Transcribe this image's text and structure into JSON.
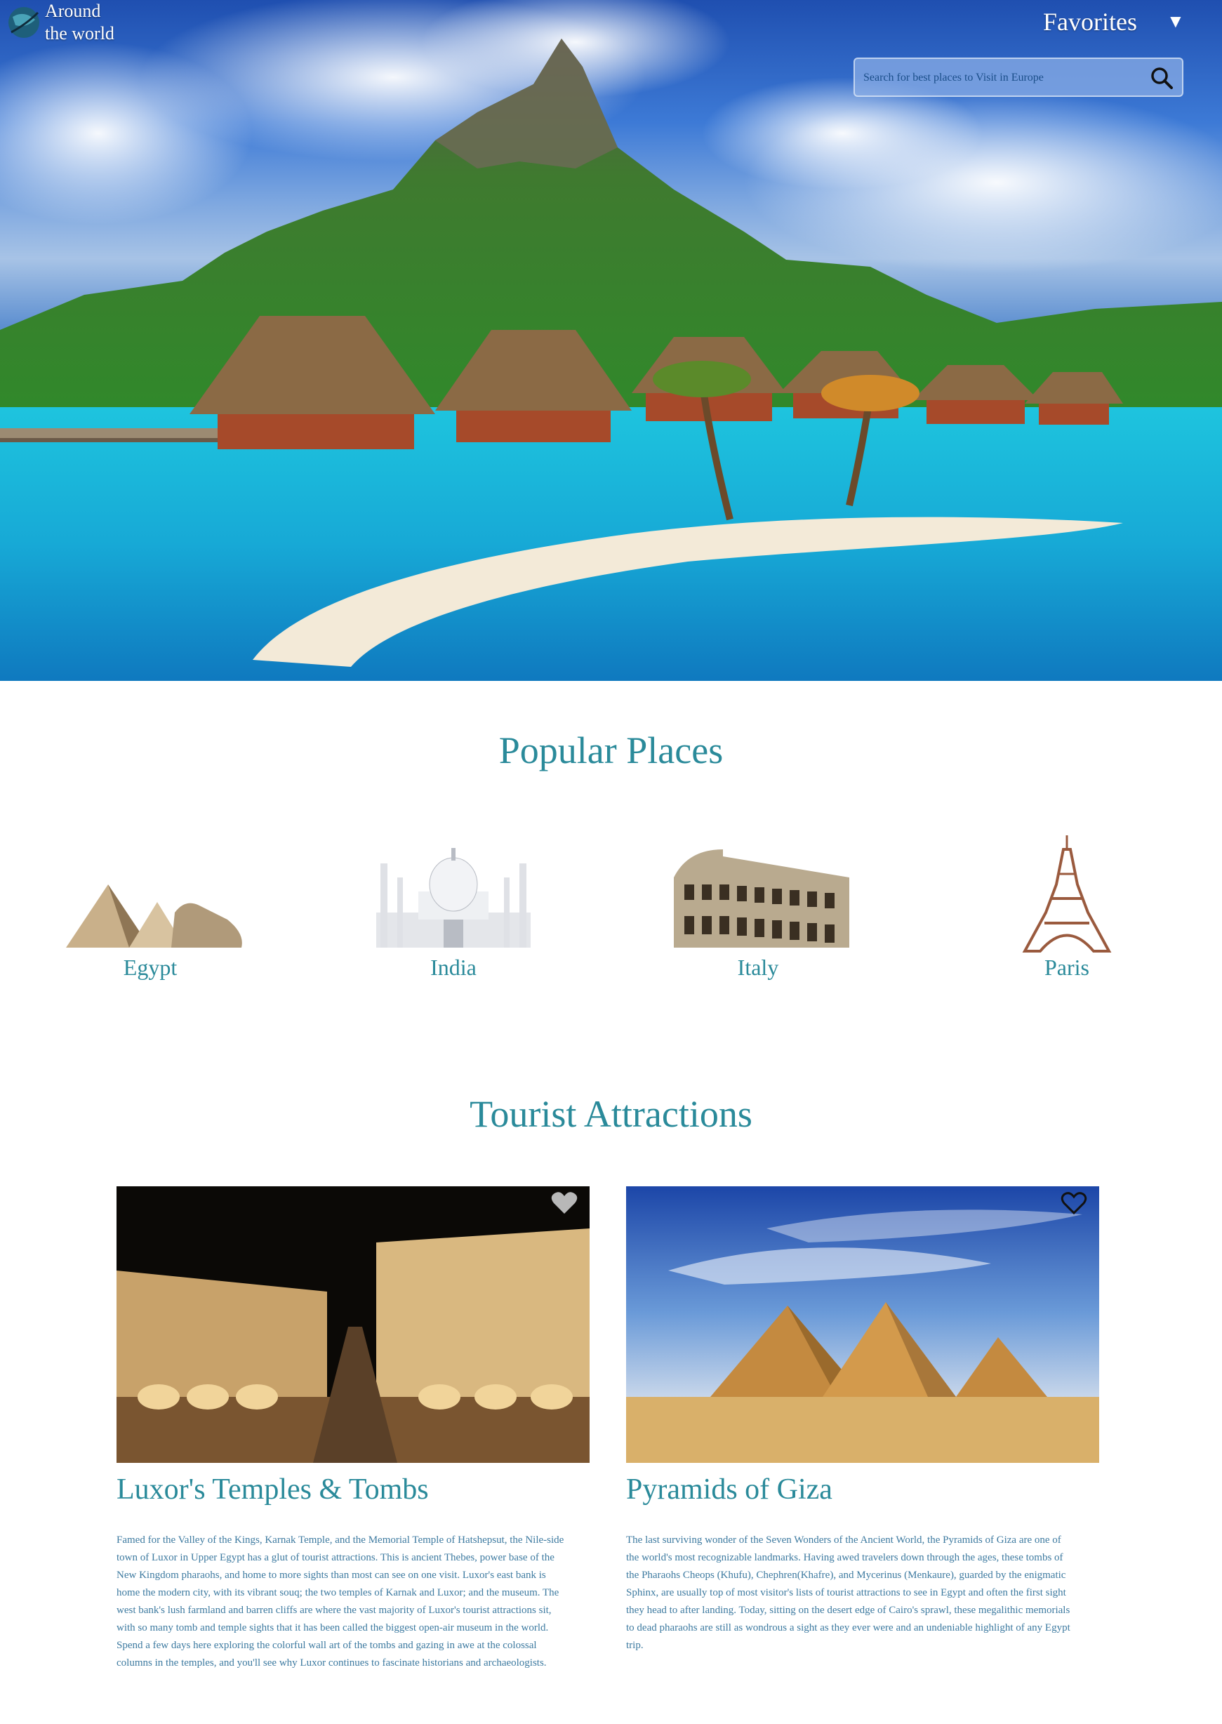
{
  "header": {
    "brand_line1": "Around",
    "brand_line2": "the world",
    "favorites_label": "Favorites",
    "favorites_caret": "▼",
    "search_placeholder": "Search for best places to Visit in Europe"
  },
  "popular": {
    "title": "Popular Places",
    "places": [
      {
        "label": "Egypt",
        "icon": "pyramids-sphinx"
      },
      {
        "label": "India",
        "icon": "taj-mahal"
      },
      {
        "label": "Italy",
        "icon": "colosseum"
      },
      {
        "label": "Paris",
        "icon": "eiffel-tower"
      }
    ]
  },
  "attractions": {
    "title": "Tourist Attractions",
    "cards": [
      {
        "title": "Luxor's Temples & Tombs",
        "favorited": true,
        "text": "Famed for the Valley of the Kings, Karnak Temple, and the Memorial Temple of Hatshepsut, the Nile-side town of Luxor in Upper Egypt has a glut of tourist attractions. This is ancient Thebes, power base of the New Kingdom pharaohs, and home to more sights than most can see on one visit. Luxor's east bank is home the modern city, with its vibrant souq; the two temples of Karnak and Luxor; and the museum. The west bank's lush farmland and barren cliffs are where the vast majority of Luxor's tourist attractions sit, with so many tomb and temple sights that it has been called the biggest open-air museum in the world. Spend a few days here exploring the colorful wall art of the tombs and gazing in awe at the colossal columns in the temples, and you'll see why Luxor continues to fascinate historians and archaeologists."
      },
      {
        "title": "Pyramids of Giza",
        "favorited": false,
        "text": "The last surviving wonder of the Seven Wonders of the Ancient World, the Pyramids of Giza are one of the world's most recognizable landmarks. Having awed travelers down through the ages, these tombs of the Pharaohs Cheops (Khufu), Chephren(Khafre), and Mycerinus (Menkaure), guarded by the enigmatic Sphinx, are usually top of most visitor's lists of tourist attractions to see in Egypt and often the first sight they head to after landing. Today, sitting on the desert edge of Cairo's sprawl, these megalithic memorials to dead pharaohs are still as wondrous a sight as they ever were and an undeniable highlight of any Egypt trip."
      }
    ]
  },
  "colors": {
    "accent_teal": "#2a8a9a",
    "body_text_blue": "#3d7aa0"
  }
}
